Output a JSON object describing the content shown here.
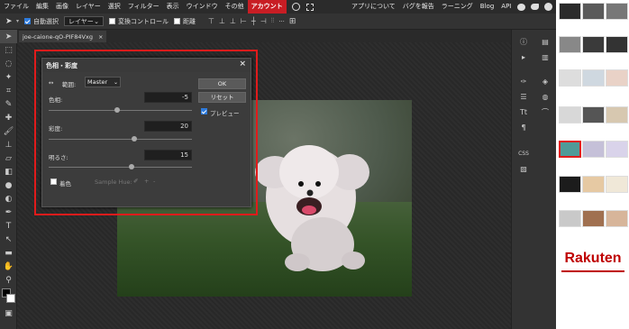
{
  "menubar": {
    "items": [
      "ファイル",
      "編集",
      "画像",
      "レイヤー",
      "選択",
      "フィルター",
      "表示",
      "ウインドウ",
      "その他"
    ],
    "account": "アカウント",
    "right_items": [
      "アプリについて",
      "バグを報告",
      "ラーニング",
      "Blog",
      "API"
    ]
  },
  "optbar": {
    "auto_select_label": "自動選択",
    "layer_select": "レイヤー",
    "transform_controls_label": "変換コントロール",
    "distance_label": "距離"
  },
  "tab": {
    "name": "joe-caione-qO-PIF84Vxg",
    "close": "×"
  },
  "dialog": {
    "title": "色相・彩度",
    "range_label": "範囲:",
    "range_value": "Master",
    "hue_label": "色相:",
    "hue_value": "-5",
    "hue_level": 0.48,
    "saturation_label": "彩度:",
    "saturation_value": "20",
    "saturation_level": 0.6,
    "lightness_label": "明るさ:",
    "lightness_value": "15",
    "lightness_level": 0.58,
    "colorize_label": "着色",
    "sample_hue_label": "Sample Hue:",
    "ok": "OK",
    "reset": "リセット",
    "preview_label": "プレビュー",
    "close": "×"
  },
  "rightpanel": {
    "css_label": "CSS"
  },
  "ads": {
    "brand": "Rakuten"
  },
  "colors": {
    "accent": "#c81d24",
    "highlight": "#e01b1b",
    "checkbox": "#2e7bdc"
  }
}
